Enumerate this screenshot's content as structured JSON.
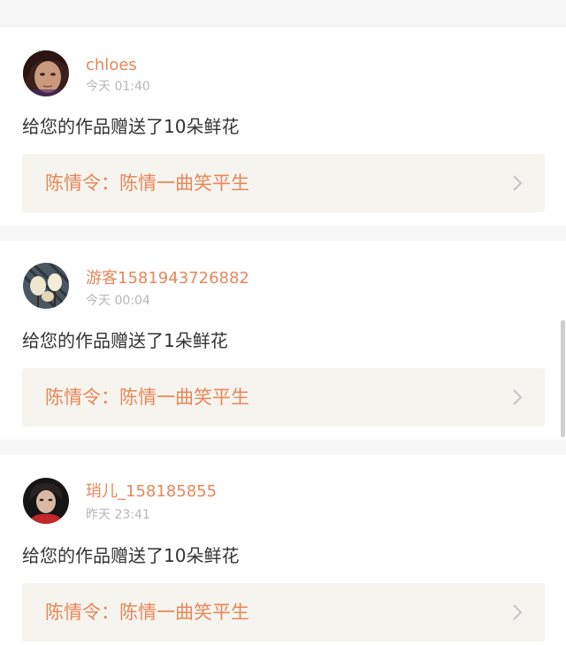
{
  "notifications": [
    {
      "username": "chloes",
      "time": "今天 01:40",
      "message": "给您的作品赠送了10朵鲜花",
      "work_title": "陈情令：陈情一曲笑平生"
    },
    {
      "username": "游客1581943726882",
      "time": "今天 00:04",
      "message": "给您的作品赠送了1朵鲜花",
      "work_title": "陈情令：陈情一曲笑平生"
    },
    {
      "username": "琑儿_158185855",
      "time": "昨天 23:41",
      "message": "给您的作品赠送了10朵鲜花",
      "work_title": "陈情令：陈情一曲笑平生"
    }
  ],
  "colors": {
    "accent": "#e8875a",
    "link_background": "#f5f4ee",
    "page_background": "#f6f6f6"
  },
  "icons": {
    "link_arrow": "chevron-right-icon"
  }
}
